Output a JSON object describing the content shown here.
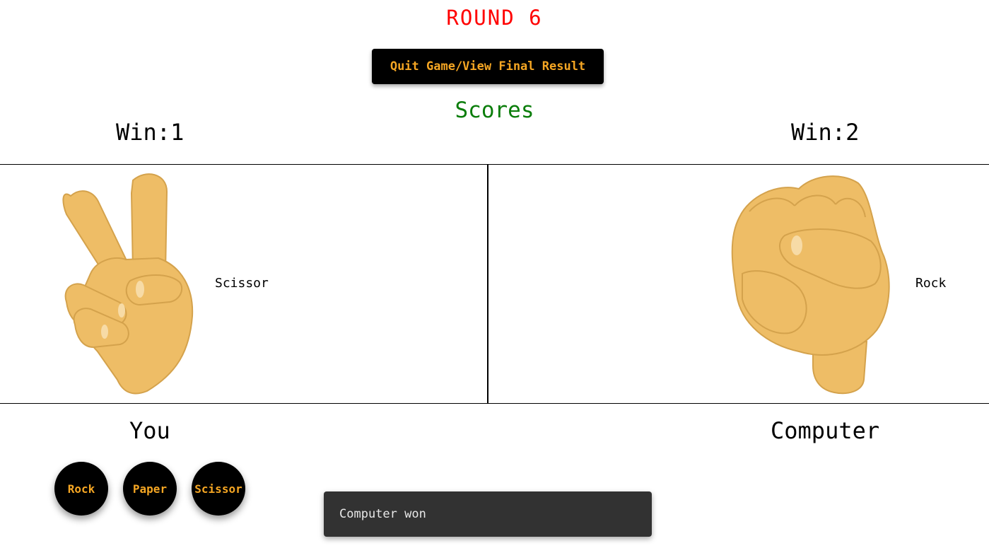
{
  "header": {
    "round_label": "ROUND 6",
    "quit_button_label": "Quit Game/View Final Result",
    "scores_title": "Scores"
  },
  "scores": {
    "you": "Win:1",
    "computer": "Win:2"
  },
  "arena": {
    "you_choice": "Scissor",
    "computer_choice": "Rock",
    "you_icon": "scissor-hand-icon",
    "computer_icon": "rock-fist-icon"
  },
  "players": {
    "you": "You",
    "computer": "Computer"
  },
  "choices": {
    "rock": "Rock",
    "paper": "Paper",
    "scissor": "Scissor"
  },
  "toast": {
    "message": "Computer won"
  },
  "colors": {
    "round": "#ff0000",
    "scores": "#0a7d0a",
    "button_bg": "#000000",
    "button_text": "#f5a623",
    "toast_bg": "#323232",
    "hand_skin": "#eebd66"
  }
}
